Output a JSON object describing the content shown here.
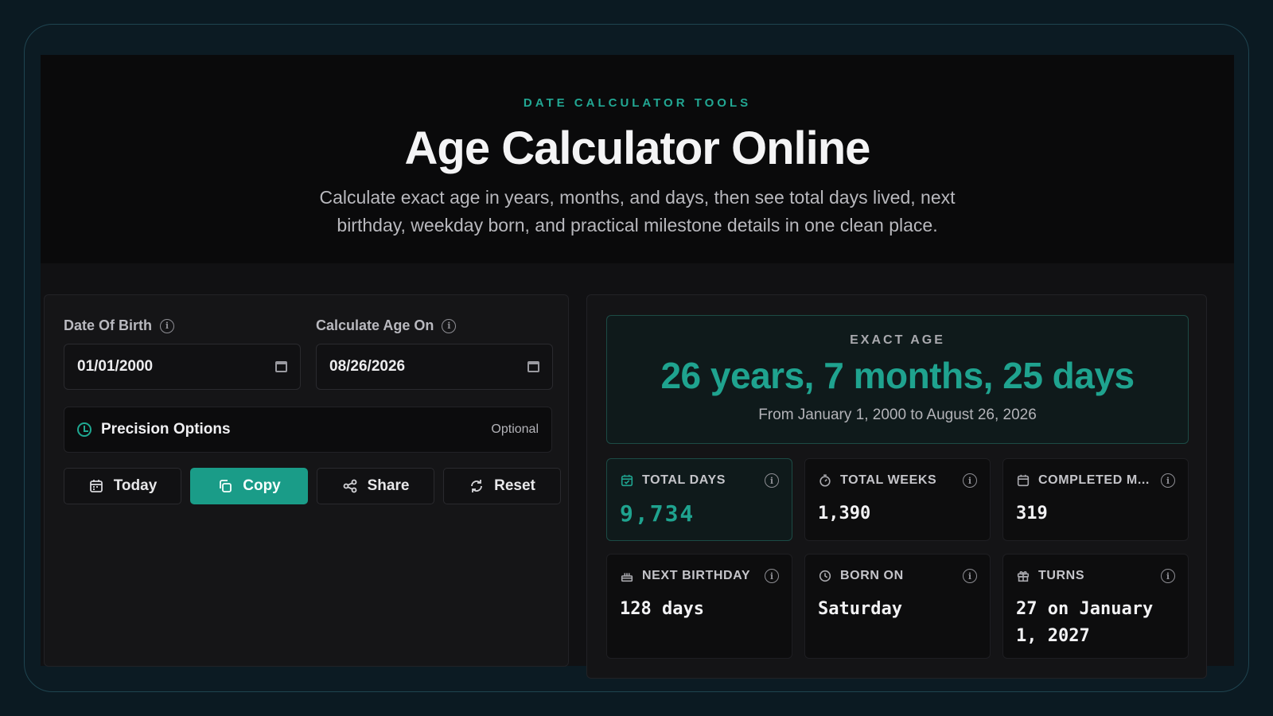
{
  "hero": {
    "eyebrow": "DATE CALCULATOR TOOLS",
    "title": "Age Calculator Online",
    "subtitle": "Calculate exact age in years, months, and days, then see total days lived, next birthday, weekday born, and practical milestone details in one clean place."
  },
  "form": {
    "dob_label": "Date Of Birth",
    "dob_value": "01/01/2000",
    "calc_on_label": "Calculate Age On",
    "calc_on_value": "08/26/2026",
    "precision_label": "Precision Options",
    "precision_hint": "Optional",
    "buttons": {
      "today": "Today",
      "copy": "Copy",
      "share": "Share",
      "reset": "Reset"
    }
  },
  "result": {
    "label": "EXACT AGE",
    "value": "26 years, 7 months, 25 days",
    "range": "From January 1, 2000 to August 26, 2026"
  },
  "stats": [
    {
      "name": "TOTAL DAYS",
      "value": "9,734",
      "icon": "calendar-icon"
    },
    {
      "name": "TOTAL WEEKS",
      "value": "1,390",
      "icon": "timer-icon"
    },
    {
      "name": "COMPLETED M...",
      "value": "319",
      "icon": "calendar-icon"
    },
    {
      "name": "NEXT BIRTHDAY",
      "value": "128 days",
      "icon": "cake-icon"
    },
    {
      "name": "BORN ON",
      "value": "Saturday",
      "icon": "history-icon"
    },
    {
      "name": "TURNS",
      "value": "27 on January 1, 2027",
      "icon": "gift-icon"
    }
  ],
  "colors": {
    "accent": "#1fa38f",
    "background": "#0b1a22",
    "panel": "#141416"
  }
}
